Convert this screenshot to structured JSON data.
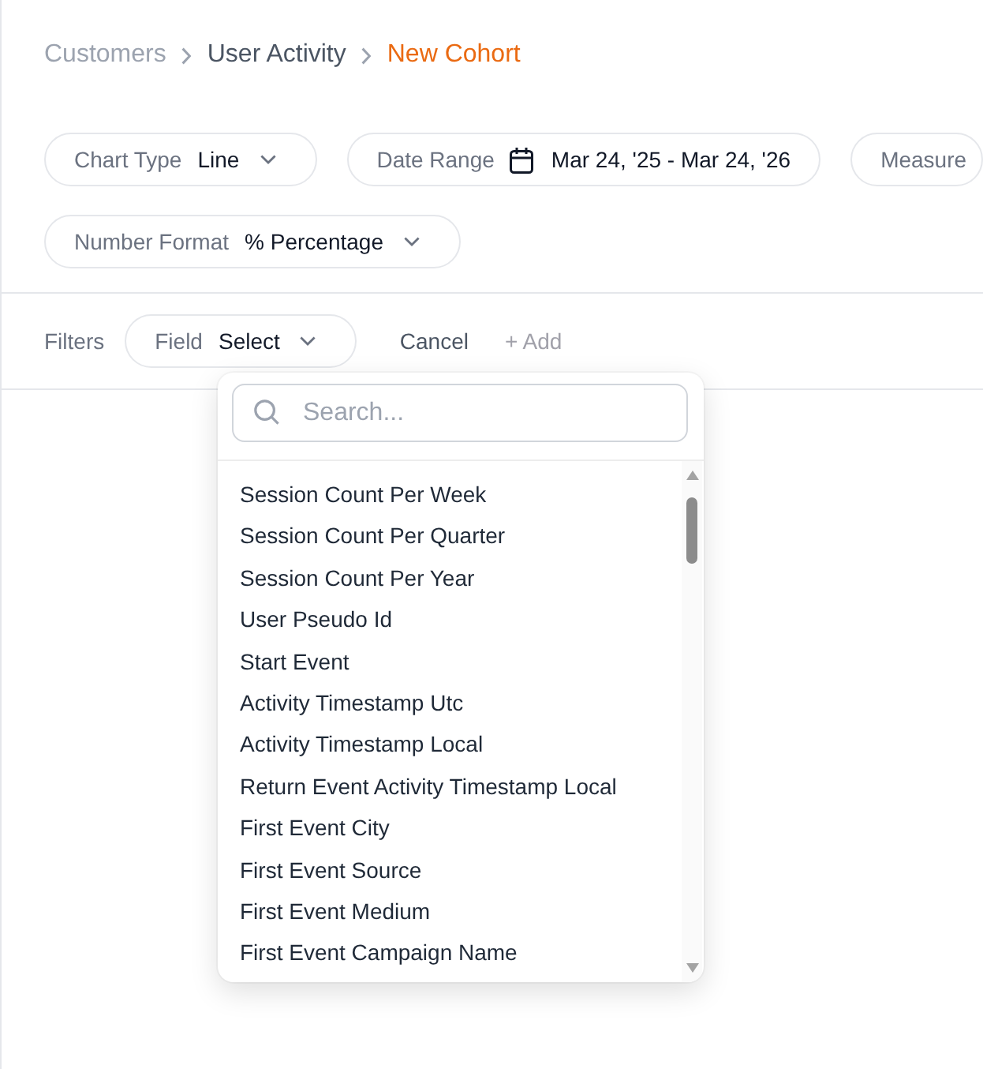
{
  "breadcrumb": [
    {
      "label": "Customers",
      "kind": "muted"
    },
    {
      "label": "User Activity",
      "kind": "link"
    },
    {
      "label": "New Cohort",
      "kind": "current"
    }
  ],
  "control_rows": [
    [
      {
        "label": "Chart Type",
        "value": "Line",
        "kind": "select"
      },
      {
        "label": "Date Range",
        "value": "Mar 24, '25 - Mar 24, '26",
        "kind": "date"
      },
      {
        "label": "Measure",
        "kind": "select"
      }
    ],
    [
      {
        "label": "Number Format",
        "value": "% Percentage",
        "kind": "select"
      }
    ]
  ],
  "filters": {
    "label": "Filters",
    "field": {
      "label": "Field",
      "value": "Select",
      "kind": "select"
    },
    "cancel": {
      "label": "Cancel"
    },
    "add": {
      "label": "+ Add",
      "disabled": true
    }
  },
  "field_dropdown": {
    "search": {
      "placeholder": "Search..."
    },
    "options": [
      "Session Count Per Week",
      "Session Count Per Quarter",
      "Session Count Per Year",
      "User Pseudo Id",
      "Start Event",
      "Activity Timestamp Utc",
      "Activity Timestamp Local",
      "Return Event Activity Timestamp Local",
      "First Event City",
      "First Event Source",
      "First Event Medium",
      "First Event Campaign Name"
    ]
  }
}
